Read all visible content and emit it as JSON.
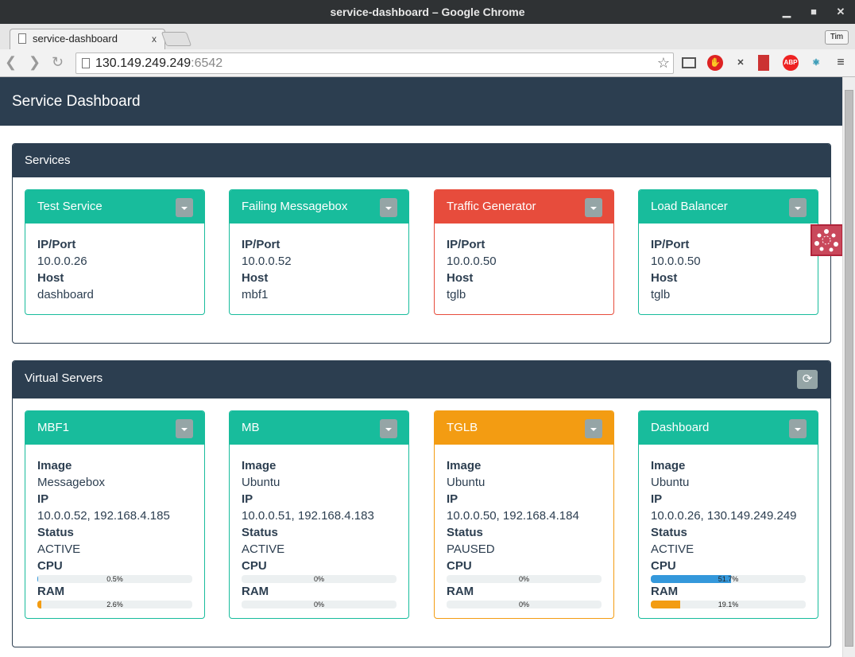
{
  "browser": {
    "window_title": "service-dashboard – Google Chrome",
    "tab_title": "service-dashboard",
    "tab_close": "x",
    "profile": "Tim",
    "url_host": "130.149.249.249",
    "url_port": ":6542",
    "ext_abp": "ABP"
  },
  "colors": {
    "navbar": "#2c3e50",
    "success": "#18bc9c",
    "danger": "#e74c3c",
    "warning": "#f39c12",
    "cpu": "#3498db",
    "ram": "#f39c12"
  },
  "navbar": {
    "title": "Service Dashboard"
  },
  "services": {
    "title": "Services",
    "cards": [
      {
        "name": "Test Service",
        "status": "success",
        "k1": "IP/Port",
        "v1": "10.0.0.26",
        "k2": "Host",
        "v2": "dashboard"
      },
      {
        "name": "Failing Messagebox",
        "status": "success",
        "k1": "IP/Port",
        "v1": "10.0.0.52",
        "k2": "Host",
        "v2": "mbf1"
      },
      {
        "name": "Traffic Generator",
        "status": "danger",
        "k1": "IP/Port",
        "v1": "10.0.0.50",
        "k2": "Host",
        "v2": "tglb"
      },
      {
        "name": "Load Balancer",
        "status": "success",
        "k1": "IP/Port",
        "v1": "10.0.0.50",
        "k2": "Host",
        "v2": "tglb"
      }
    ]
  },
  "servers": {
    "title": "Virtual Servers",
    "refresh_icon": "refresh-icon",
    "labels": {
      "image": "Image",
      "ip": "IP",
      "status": "Status",
      "cpu": "CPU",
      "ram": "RAM"
    },
    "cards": [
      {
        "name": "MBF1",
        "state": "success",
        "image": "Messagebox",
        "ip": "10.0.0.52, 192.168.4.185",
        "status": "ACTIVE",
        "cpu": 0.5,
        "cpu_label": "0.5%",
        "ram": 2.6,
        "ram_label": "2.6%"
      },
      {
        "name": "MB",
        "state": "success",
        "image": "Ubuntu",
        "ip": "10.0.0.51, 192.168.4.183",
        "status": "ACTIVE",
        "cpu": 0,
        "cpu_label": "0%",
        "ram": 0,
        "ram_label": "0%"
      },
      {
        "name": "TGLB",
        "state": "warning",
        "image": "Ubuntu",
        "ip": "10.0.0.50, 192.168.4.184",
        "status": "PAUSED",
        "cpu": 0,
        "cpu_label": "0%",
        "ram": 0,
        "ram_label": "0%"
      },
      {
        "name": "Dashboard",
        "state": "success",
        "image": "Ubuntu",
        "ip": "10.0.0.26, 130.149.249.249",
        "status": "ACTIVE",
        "cpu": 51.7,
        "cpu_label": "51.7%",
        "ram": 19.1,
        "ram_label": "19.1%"
      }
    ]
  }
}
